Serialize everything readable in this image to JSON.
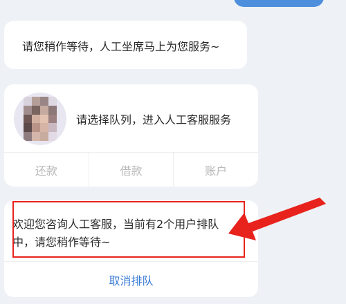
{
  "chat": {
    "wait_message": "请您稍作等待，人工坐席马上为您服务~",
    "queue_prompt": "请选择队列，进入人工客服服务",
    "queue_options": [
      {
        "label": "还款"
      },
      {
        "label": "借款"
      },
      {
        "label": "账户"
      }
    ],
    "status_message": "欢迎您咨询人工客服，当前有2个用户排队中，请您稍作等待~",
    "cancel_label": "取消排队"
  },
  "annotation": {
    "highlight_color": "#e8221c",
    "arrow_icon": "red-arrow-icon"
  },
  "colors": {
    "background": "#eef1f5",
    "user_bubble": "#4d8fdc",
    "link_blue": "#3a7bd5",
    "option_gray": "#b8b8b8"
  }
}
